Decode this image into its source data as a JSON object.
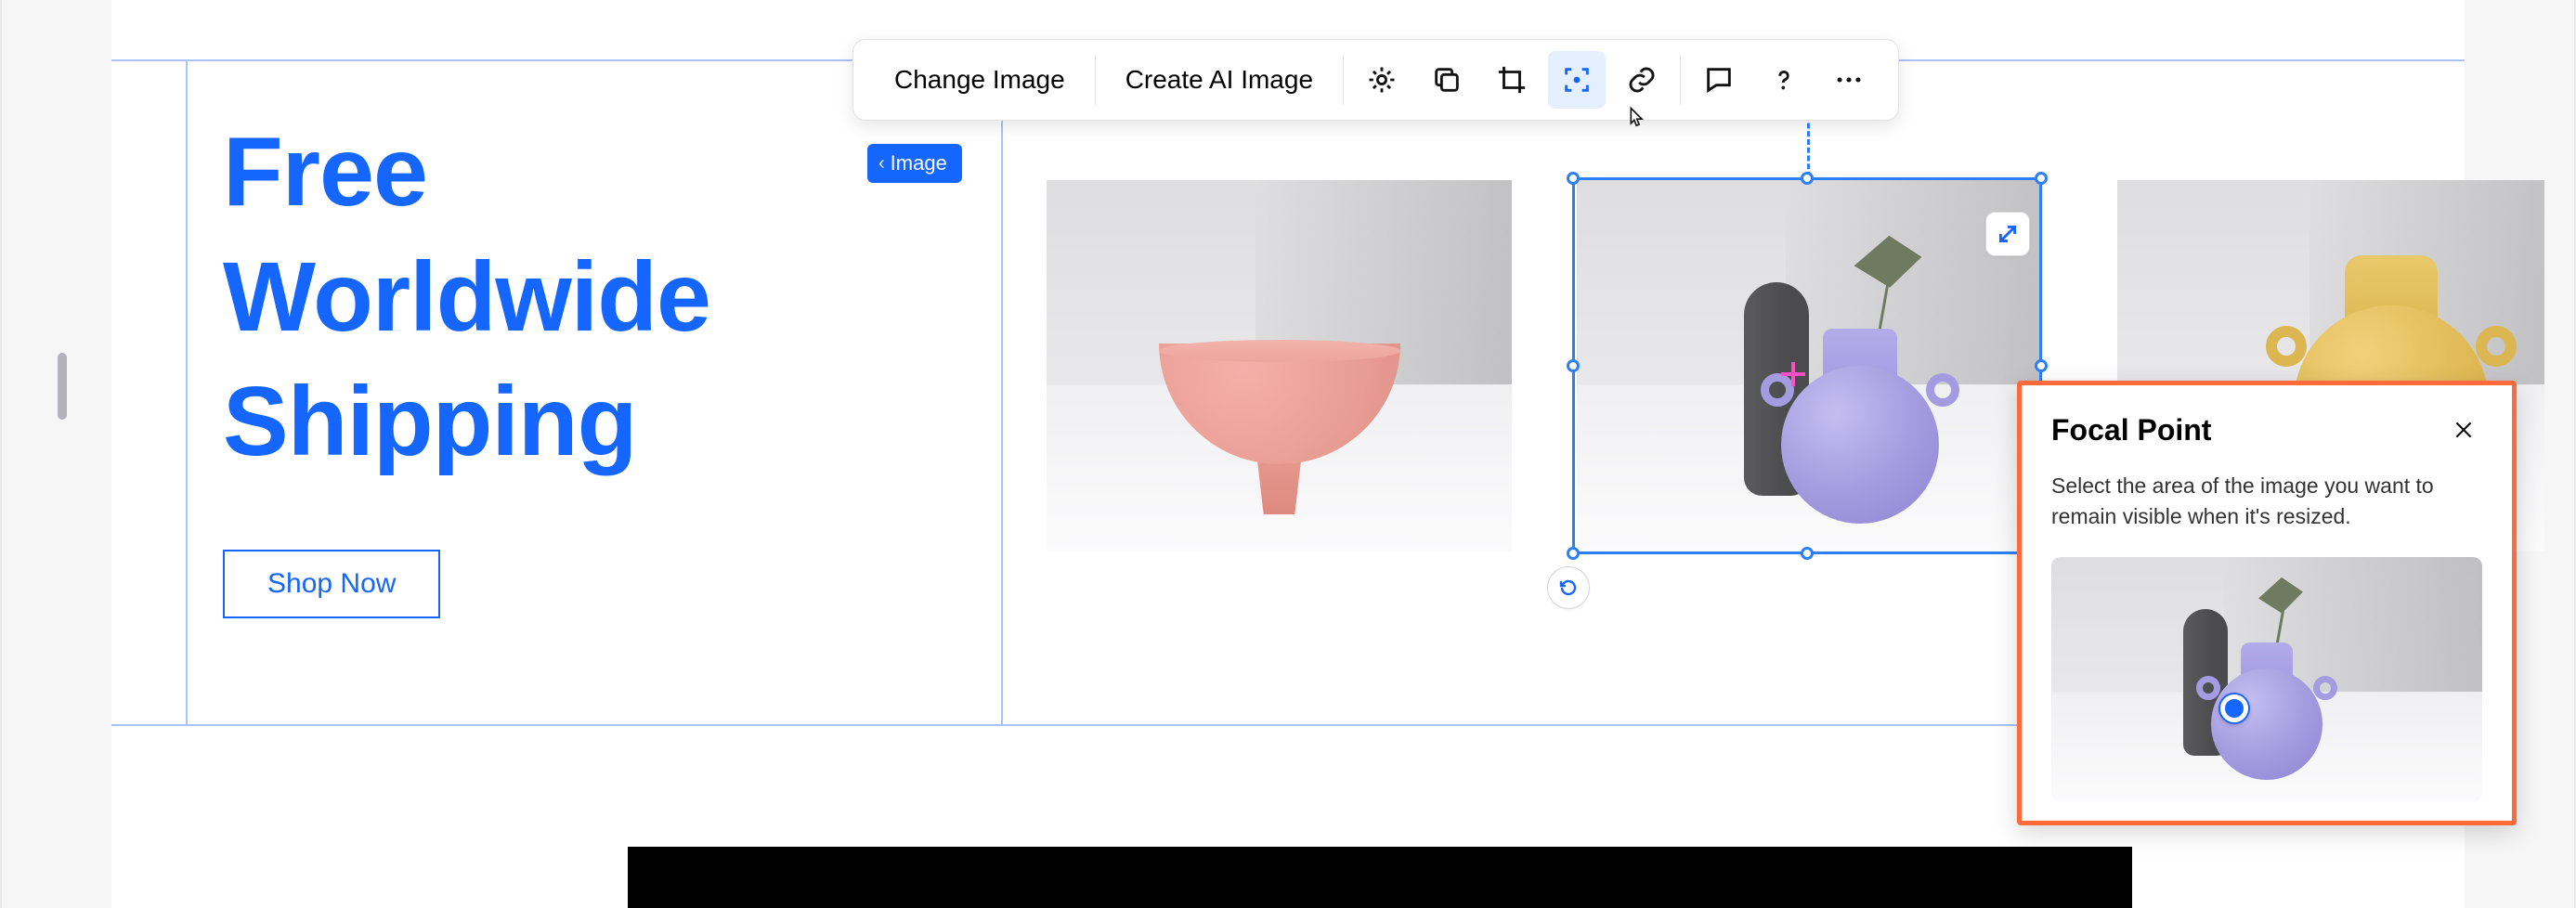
{
  "promo": {
    "line1": "Free",
    "line2": "Worldwide",
    "line3": "Shipping",
    "cta": "Shop Now"
  },
  "breadcrumb": {
    "label": "Image"
  },
  "toolbar": {
    "change_image": "Change Image",
    "create_ai_image": "Create AI Image",
    "icons": {
      "settings": "settings-gear-icon",
      "duplicate": "duplicate-icon",
      "crop": "crop-icon",
      "focal": "focal-point-icon",
      "link": "link-icon",
      "comment": "comment-icon",
      "help": "help-icon",
      "more": "more-icon"
    }
  },
  "popover": {
    "title": "Focal Point",
    "description": "Select the area of the image you want to remain visible when it's resized."
  },
  "colors": {
    "brand_blue": "#1566ff",
    "selection_blue": "#2d7ff9",
    "highlight_orange": "#ff6a3c",
    "focal_pink": "#ff4fc6"
  }
}
